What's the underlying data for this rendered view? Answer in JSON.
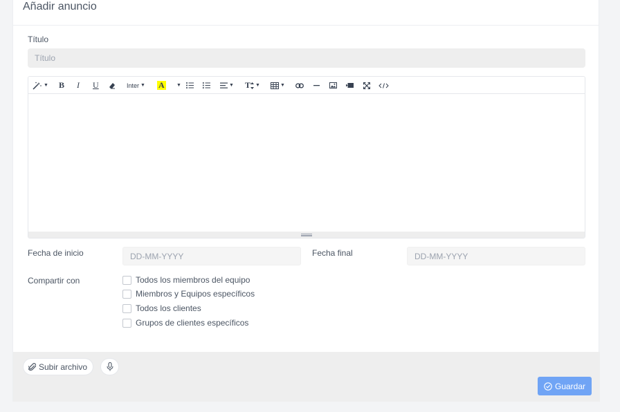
{
  "header": {
    "title": "Añadir anuncio"
  },
  "form": {
    "title_label": "Título",
    "title_placeholder": "Título",
    "start_date_label": "Fecha de inicio",
    "start_date_placeholder": "DD-MM-YYYY",
    "end_date_label": "Fecha final",
    "end_date_placeholder": "DD-MM-YYYY",
    "share_label": "Compartir con",
    "share_options": [
      "Todos los miembros del equipo",
      "Miembros y Equipos específicos",
      "Todos los clientes",
      "Grupos de clientes específicos"
    ]
  },
  "toolbar": {
    "bold": "B",
    "italic": "I",
    "underline": "U",
    "font_name": "Inter",
    "font_color": "A",
    "font_size": "T",
    "icons": [
      "magic-icon",
      "bold-icon",
      "italic-icon",
      "underline-icon",
      "eraser-icon",
      "font-name-dropdown",
      "font-color-icon",
      "unordered-list-icon",
      "ordered-list-icon",
      "align-icon",
      "font-size-icon",
      "table-icon",
      "link-icon",
      "horizontal-rule-icon",
      "image-icon",
      "video-icon",
      "fullscreen-icon",
      "code-view-icon"
    ]
  },
  "footer": {
    "upload_label": "Subir archivo",
    "save_label": "Guardar"
  },
  "colors": {
    "accent": "#70a4f5",
    "highlight": "#ffff00"
  }
}
